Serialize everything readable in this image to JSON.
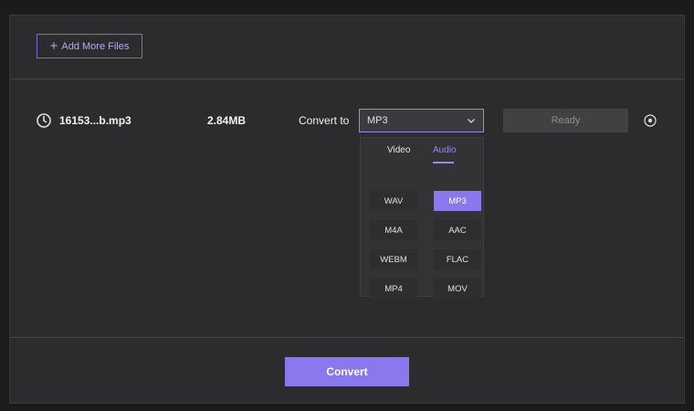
{
  "toolbar": {
    "add_files_label": "Add More Files"
  },
  "file": {
    "name": "16153...b.mp3",
    "size": "2.84MB",
    "convert_to_label": "Convert to",
    "selected_format": "MP3",
    "status": "Ready"
  },
  "dropdown": {
    "tabs": [
      {
        "label": "Video",
        "active": false
      },
      {
        "label": "Audio",
        "active": true
      }
    ],
    "formats": [
      {
        "label": "WAV",
        "selected": false
      },
      {
        "label": "MP3",
        "selected": true
      },
      {
        "label": "M4A",
        "selected": false
      },
      {
        "label": "AAC",
        "selected": false
      },
      {
        "label": "WEBM",
        "selected": false
      },
      {
        "label": "FLAC",
        "selected": false
      },
      {
        "label": "MP4",
        "selected": false
      },
      {
        "label": "MOV",
        "selected": false
      }
    ]
  },
  "actions": {
    "convert_label": "Convert"
  },
  "colors": {
    "accent": "#8b77ee",
    "background": "#2c2c2e",
    "page": "#1b1b1b"
  },
  "icons": {
    "file": "audio-file-icon",
    "dropdown": "chevron-down-icon",
    "remove": "close-circle-icon",
    "add": "plus-icon"
  }
}
